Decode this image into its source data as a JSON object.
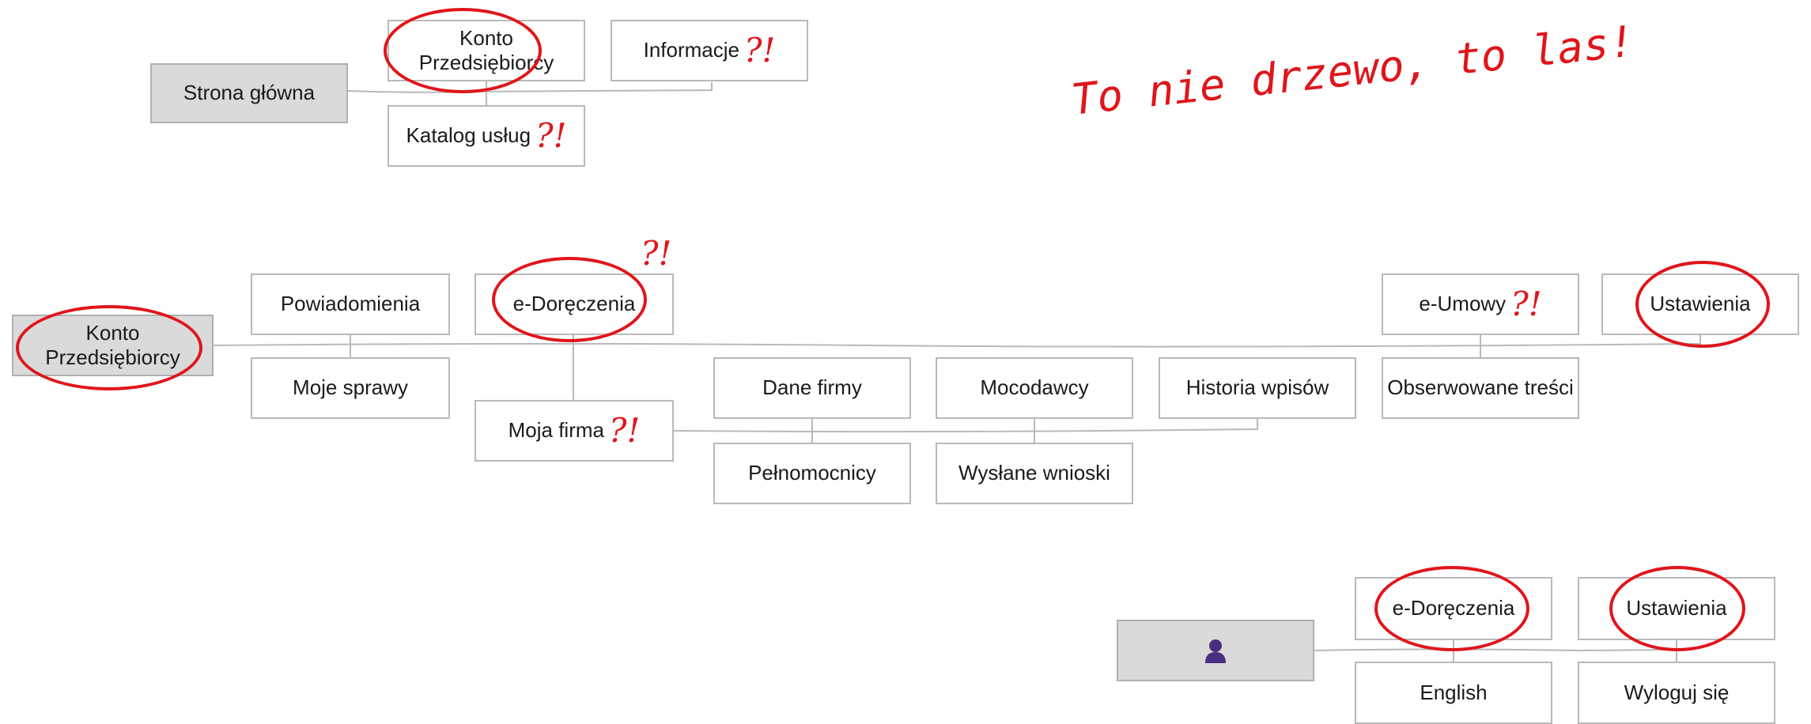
{
  "note": "To nie drzewo, to las!",
  "question_mark": "?!",
  "colors": {
    "accent": "#e0151b",
    "box_border": "#b9b9b9",
    "root_fill": "#dadada",
    "person_icon": "#4b2d7f"
  },
  "diagram1": {
    "root": "Strona główna",
    "konto": "Konto\nPrzedsiębiorcy",
    "informacje": "Informacje",
    "katalog": "Katalog usług"
  },
  "diagram2": {
    "root": "Konto\nPrzedsiębiorcy",
    "powiadomienia": "Powiadomienia",
    "moje_sprawy": "Moje sprawy",
    "e_doreczenia": "e-Doręczenia",
    "moja_firma": "Moja firma",
    "dane_firmy": "Dane firmy",
    "pelnomocnicy": "Pełnomocnicy",
    "mocodawcy": "Mocodawcy",
    "wyslane_wnioski": "Wysłane wnioski",
    "historia_wpisow": "Historia wpisów",
    "e_umowy": "e-Umowy",
    "obserwowane": "Obserwowane treści",
    "ustawienia": "Ustawienia"
  },
  "diagram3": {
    "root_icon": "person-icon",
    "e_doreczenia": "e-Doręczenia",
    "english": "English",
    "ustawienia": "Ustawienia",
    "wyloguj": "Wyloguj się"
  }
}
